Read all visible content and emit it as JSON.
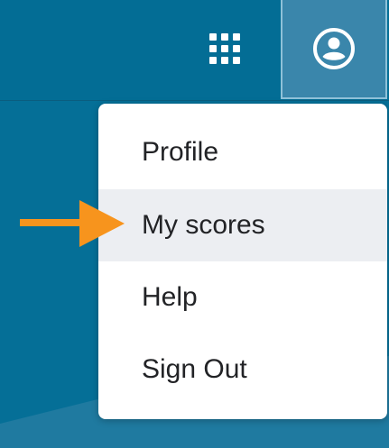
{
  "header": {
    "apps_icon": "apps-grid-icon",
    "user_icon": "user-circle-icon"
  },
  "menu": {
    "items": [
      {
        "label": "Profile",
        "active": false
      },
      {
        "label": "My scores",
        "active": true
      },
      {
        "label": "Help",
        "active": false
      },
      {
        "label": "Sign Out",
        "active": false
      }
    ]
  },
  "annotation": {
    "arrow_icon": "right-arrow-icon",
    "arrow_color": "#f7941d"
  },
  "colors": {
    "background": "#056f97",
    "topbar": "#036d95",
    "user_button": "#3a86ab",
    "menu_active": "#eceef2"
  }
}
